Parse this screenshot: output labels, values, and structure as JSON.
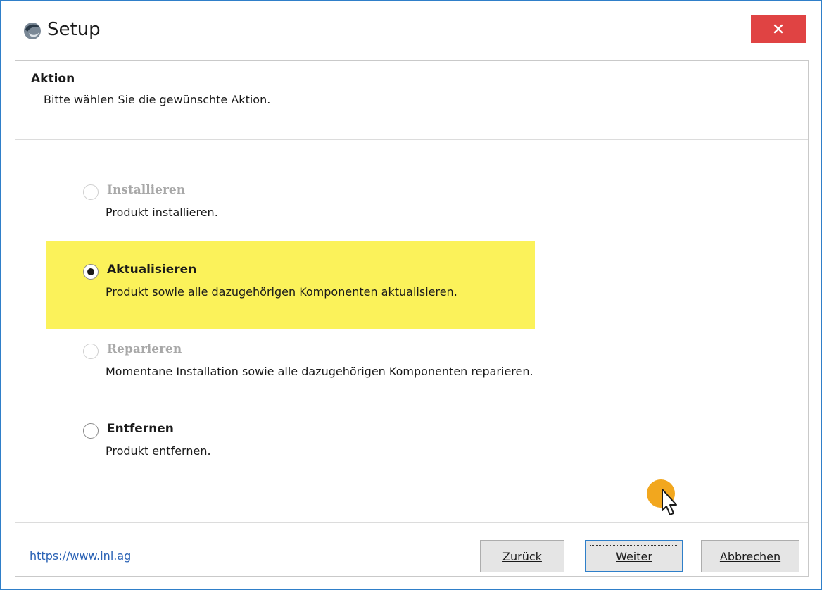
{
  "window": {
    "title": "Setup",
    "close_glyph": "×"
  },
  "header": {
    "title": "Aktion",
    "subtitle": "Bitte wählen Sie die gewünschte Aktion."
  },
  "options": [
    {
      "label": "Installieren",
      "description": "Produkt installieren.",
      "state": "disabled"
    },
    {
      "label": "Aktualisieren",
      "description": "Produkt sowie alle dazugehörigen Komponenten aktualisieren.",
      "state": "selected"
    },
    {
      "label": "Reparieren",
      "description": "Momentane Installation sowie alle dazugehörigen Komponenten reparieren.",
      "state": "disabled"
    },
    {
      "label": "Entfernen",
      "description": "Produkt entfernen.",
      "state": "enabled"
    }
  ],
  "footer": {
    "link": "https://www.inl.ag",
    "back_label": "Zurück",
    "next_label": "Weiter",
    "cancel_label": "Abbrechen"
  },
  "colors": {
    "highlight": "#fbf25a",
    "close_button": "#e04343",
    "link": "#2a62b5",
    "cursor_marker": "#f2a71e",
    "window_border": "#2f7fc9"
  },
  "icons": {
    "app": "setup-app-icon",
    "close": "close-icon",
    "cursor": "mouse-pointer-icon"
  }
}
